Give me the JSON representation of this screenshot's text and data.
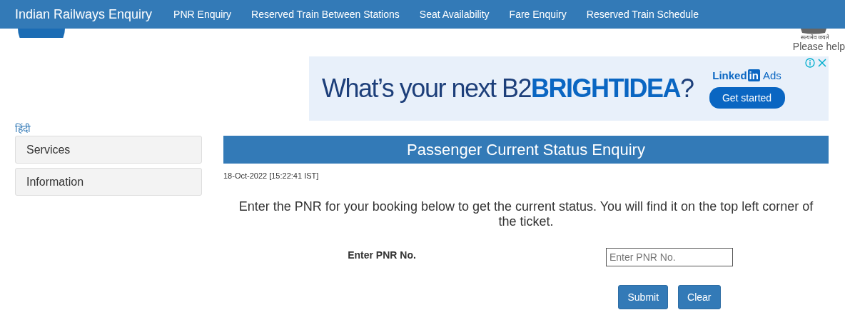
{
  "navbar": {
    "brand": "Indian Railways Enquiry",
    "links": [
      {
        "label": "PNR Enquiry"
      },
      {
        "label": "Reserved Train Between Stations"
      },
      {
        "label": "Seat Availability"
      },
      {
        "label": "Fare Enquiry"
      },
      {
        "label": "Reserved Train Schedule"
      }
    ]
  },
  "emblem": {
    "motto": "सत्यमेव जयते"
  },
  "help_text": "Please help",
  "ad": {
    "headline": "What’s your next B2**BRIGHTIDEA**?",
    "brand": "Linked",
    "brand_box": "in",
    "brand_suffix": "Ads",
    "cta": "Get started"
  },
  "sidebar": {
    "language_link": "हिंदी",
    "items": [
      {
        "label": "Services"
      },
      {
        "label": "Information"
      }
    ]
  },
  "main": {
    "title": "Passenger Current Status Enquiry",
    "timestamp": "18-Oct-2022 [15:22:41 IST]",
    "instructions": "Enter the PNR for your booking below to get the current status. You will find it on the top left corner of the ticket.",
    "form": {
      "label": "Enter PNR No.",
      "placeholder": "Enter PNR No."
    },
    "buttons": [
      {
        "label": "Submit"
      },
      {
        "label": "Clear"
      }
    ]
  }
}
